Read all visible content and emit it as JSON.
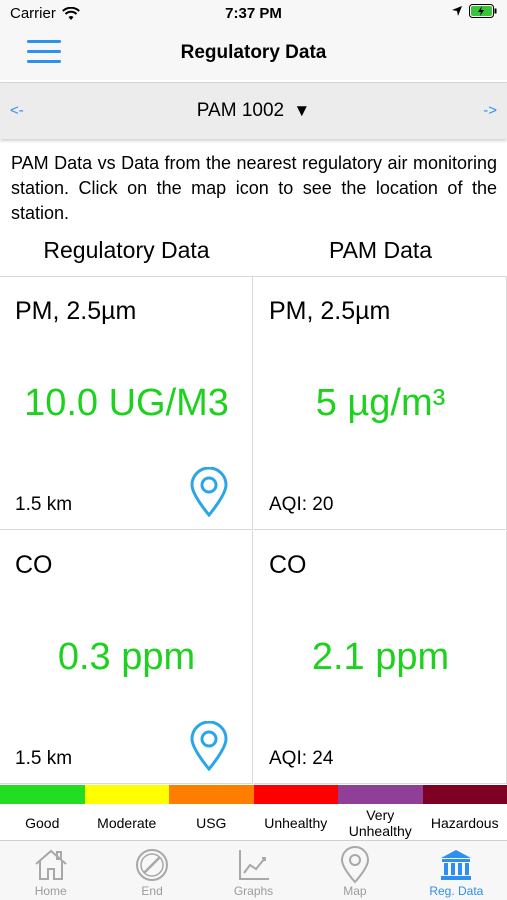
{
  "status_bar": {
    "carrier": "Carrier",
    "time": "7:37 PM"
  },
  "nav": {
    "title": "Regulatory Data"
  },
  "device_selector": {
    "prev": "<-",
    "device": "PAM 1002",
    "caret": "▼",
    "next": "->"
  },
  "description": "PAM Data vs Data from the nearest regulatory air monitoring station. Click on the map icon to see the location of the station.",
  "columns": {
    "left": "Regulatory Data",
    "right": "PAM Data"
  },
  "cells": [
    {
      "pollutant": "PM, 2.5µm",
      "value": "10.0 UG/M3",
      "foot": "1.5 km"
    },
    {
      "pollutant": "PM, 2.5µm",
      "value": "5 µg/m³",
      "foot": "AQI: 20"
    },
    {
      "pollutant": "CO",
      "value": "0.3 ppm",
      "foot": "1.5 km"
    },
    {
      "pollutant": "CO",
      "value": "2.1 ppm",
      "foot": "AQI: 24"
    }
  ],
  "colors": {
    "accent": "#2d8ff0",
    "value_green": "#1fd11f"
  },
  "aqi_scale": [
    {
      "label": "Good",
      "color": "#22dd22"
    },
    {
      "label": "Moderate",
      "color": "#ffff00"
    },
    {
      "label": "USG",
      "color": "#ff7e00"
    },
    {
      "label": "Unhealthy",
      "color": "#ff0000"
    },
    {
      "label": "Very Unhealthy",
      "color": "#8f3f97"
    },
    {
      "label": "Hazardous",
      "color": "#7e0023"
    }
  ],
  "tabs": [
    {
      "label": "Home",
      "icon": "home-icon"
    },
    {
      "label": "End",
      "icon": "end-icon"
    },
    {
      "label": "Graphs",
      "icon": "graphs-icon"
    },
    {
      "label": "Map",
      "icon": "map-pin-icon"
    },
    {
      "label": "Reg. Data",
      "icon": "reg-data-icon",
      "active": true
    }
  ]
}
